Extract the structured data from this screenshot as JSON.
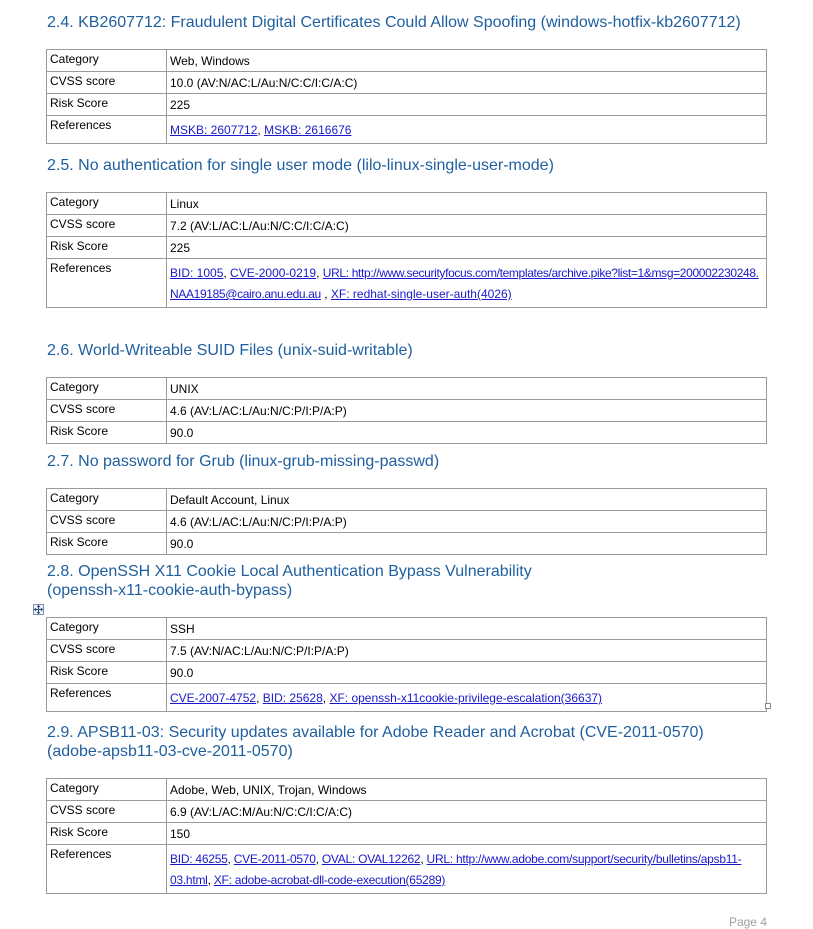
{
  "sections": [
    {
      "heading": "2.4. KB2607712: Fraudulent Digital Certificates Could Allow Spoofing (windows-hotfix-kb2607712)",
      "rows": [
        {
          "key": "Category",
          "value": "Web, Windows"
        },
        {
          "key": "CVSS score",
          "value": "10.0 (AV:N/AC:L/Au:N/C:C/I:C/A:C)"
        },
        {
          "key": "Risk Score",
          "value": "225"
        }
      ],
      "references_label": "References",
      "references": [
        {
          "text": "MSKB: 2607712",
          "sep": ", "
        },
        {
          "text": "MSKB: 2616676",
          "sep": ""
        }
      ]
    },
    {
      "heading": "2.5. No authentication for single user mode (lilo-linux-single-user-mode)",
      "rows": [
        {
          "key": "Category",
          "value": "Linux"
        },
        {
          "key": "CVSS score",
          "value": "7.2 (AV:L/AC:L/Au:N/C:C/I:C/A:C)"
        },
        {
          "key": "Risk Score",
          "value": "225"
        }
      ],
      "references_label": "References",
      "references": [
        {
          "text": "BID: 1005",
          "sep": ", "
        },
        {
          "text": "CVE-2000-0219",
          "sep": ", "
        },
        {
          "text": "URL: http://www.securityfocus.com/templates/archive.pike?list=1&msg=200002230248.NAA19185@cairo.anu.edu.au",
          "sep": " , "
        },
        {
          "text": "XF: redhat-single-user-auth(4026)",
          "sep": ""
        }
      ]
    },
    {
      "heading": "2.6. World-Writeable SUID Files (unix-suid-writable)",
      "rows": [
        {
          "key": "Category",
          "value": "UNIX"
        },
        {
          "key": "CVSS score",
          "value": "4.6 (AV:L/AC:L/Au:N/C:P/I:P/A:P)"
        },
        {
          "key": "Risk Score",
          "value": "90.0"
        }
      ]
    },
    {
      "heading": "2.7. No password for Grub (linux-grub-missing-passwd)",
      "rows": [
        {
          "key": "Category",
          "value": "Default Account, Linux"
        },
        {
          "key": "CVSS score",
          "value": "4.6 (AV:L/AC:L/Au:N/C:P/I:P/A:P)"
        },
        {
          "key": "Risk Score",
          "value": "90.0"
        }
      ]
    },
    {
      "heading": "2.8. OpenSSH X11 Cookie Local Authentication Bypass Vulnerability",
      "heading_line2": "(openssh-x11-cookie-auth-bypass)",
      "rows": [
        {
          "key": "Category",
          "value": "SSH"
        },
        {
          "key": "CVSS score",
          "value": "7.5 (AV:N/AC:L/Au:N/C:P/I:P/A:P)"
        },
        {
          "key": "Risk Score",
          "value": "90.0"
        }
      ],
      "references_label": "References",
      "references": [
        {
          "text": "CVE-2007-4752",
          "sep": ", "
        },
        {
          "text": "BID: 25628",
          "sep": ", "
        },
        {
          "text": "XF: openssh-x11cookie-privilege-escalation(36637)",
          "sep": ""
        }
      ]
    },
    {
      "heading": "2.9. APSB11-03: Security updates available for Adobe Reader and Acrobat (CVE-2011-0570)",
      "heading_line2": "(adobe-apsb11-03-cve-2011-0570)",
      "rows": [
        {
          "key": "Category",
          "value": "Adobe, Web, UNIX, Trojan, Windows"
        },
        {
          "key": "CVSS score",
          "value": "6.9 (AV:L/AC:M/Au:N/C:C/I:C/A:C)"
        },
        {
          "key": "Risk Score",
          "value": "150"
        }
      ],
      "references_label": "References",
      "references": [
        {
          "text": "BID: 46255",
          "sep": ", "
        },
        {
          "text": "CVE-2011-0570",
          "sep": ", "
        },
        {
          "text": "OVAL: OVAL12262",
          "sep": ", "
        },
        {
          "text": "URL: http://www.adobe.com/support/security/bulletins/apsb11-03.html",
          "sep": ", "
        },
        {
          "text": "XF: adobe-acrobat-dll-code-execution(65289)",
          "sep": ""
        }
      ]
    }
  ],
  "footer": {
    "page_label": "Page 4"
  },
  "icons": {
    "move_handle": "table-move-handle-icon",
    "resize_handle": "table-resize-handle-icon"
  },
  "colors": {
    "heading": "#1f5f9f",
    "link": "#1a1acc",
    "border": "#9a9a9a",
    "footer": "#a0a0a0"
  }
}
